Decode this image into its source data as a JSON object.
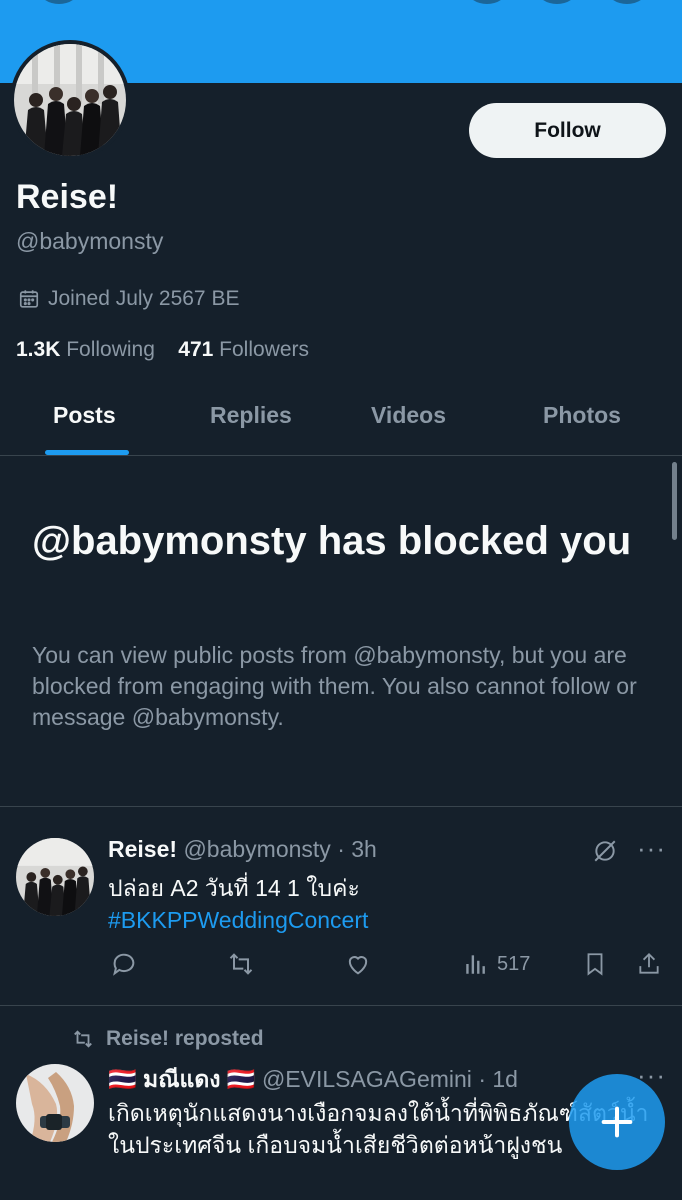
{
  "profile": {
    "display_name": "Reise!",
    "handle": "@babymonsty",
    "joined": "Joined July 2567 BE",
    "following_count": "1.3K",
    "following_label": "Following",
    "followers_count": "471",
    "followers_label": "Followers",
    "follow_label": "Follow"
  },
  "tabs": [
    {
      "label": "Posts",
      "active": true
    },
    {
      "label": "Replies",
      "active": false
    },
    {
      "label": "Videos",
      "active": false
    },
    {
      "label": "Photos",
      "active": false
    }
  ],
  "blocked_notice": {
    "title": "@babymonsty has blocked you",
    "body": "You can view public posts from @babymonsty, but you are blocked from engaging with them. You also cannot follow or message @babymonsty."
  },
  "posts": [
    {
      "author": "Reise!",
      "handle": "@babymonsty",
      "time": "· 3h",
      "text": "ปล่อย A2 วันที่ 14 1 ใบค่ะ",
      "hashtag": "#BKKPPWeddingConcert",
      "views": "517"
    },
    {
      "repost_label": "Reise! reposted",
      "author": "🇹🇭 มณีแดง 🇹🇭",
      "handle": "@EVILSAGAGemini",
      "time": "· 1d",
      "text": "เกิดเหตุนักแสดงนางเงือกจมลงใต้น้ำที่พิพิธภัณฑ์สัตว์น้ำในประเทศจีน เกือบจมน้ำเสียชีวิตต่อหน้าฝูงชน"
    }
  ],
  "icons": {
    "calendar": "calendar-icon",
    "reply": "reply-icon",
    "repost": "repost-icon",
    "like": "like-icon",
    "views": "views-icon",
    "bookmark": "bookmark-icon",
    "share": "share-icon",
    "grok": "grok-icon",
    "more": "more-icon",
    "compose": "compose-plus-icon"
  },
  "colors": {
    "background": "#15202b",
    "accent": "#1d9bf0",
    "muted": "#8b98a5",
    "text": "#f7f9f9"
  }
}
